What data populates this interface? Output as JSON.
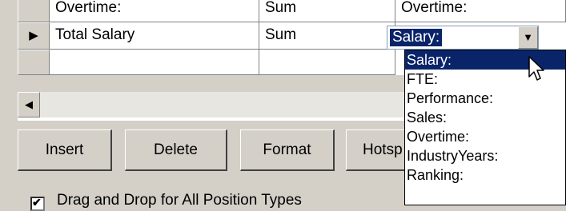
{
  "grid": {
    "rows": [
      {
        "name": "Overtime:",
        "aggregate": "Sum",
        "field": "Overtime:"
      },
      {
        "name": "Total Salary",
        "aggregate": "Sum",
        "field": "Salary:"
      },
      {
        "name": "",
        "aggregate": "",
        "field": ""
      }
    ],
    "current_row_marker": "▶"
  },
  "combo": {
    "value": "Salary:",
    "arrow": "▼"
  },
  "dropdown": {
    "options": [
      "Salary:",
      "FTE:",
      "Performance:",
      "Sales:",
      "Overtime:",
      "IndustryYears:",
      "Ranking:"
    ],
    "selected": "Salary:"
  },
  "scrollbar": {
    "left_arrow": "◀"
  },
  "buttons": {
    "insert": "Insert",
    "delete": "Delete",
    "format": "Format",
    "hotspot": "Hotsp"
  },
  "checkbox": {
    "label": "Drag and Drop for All Position Types",
    "checked": true,
    "mark": "✔"
  },
  "colors": {
    "selection": "#0a246a",
    "face": "#d4d0c8",
    "window": "#ffffff"
  }
}
